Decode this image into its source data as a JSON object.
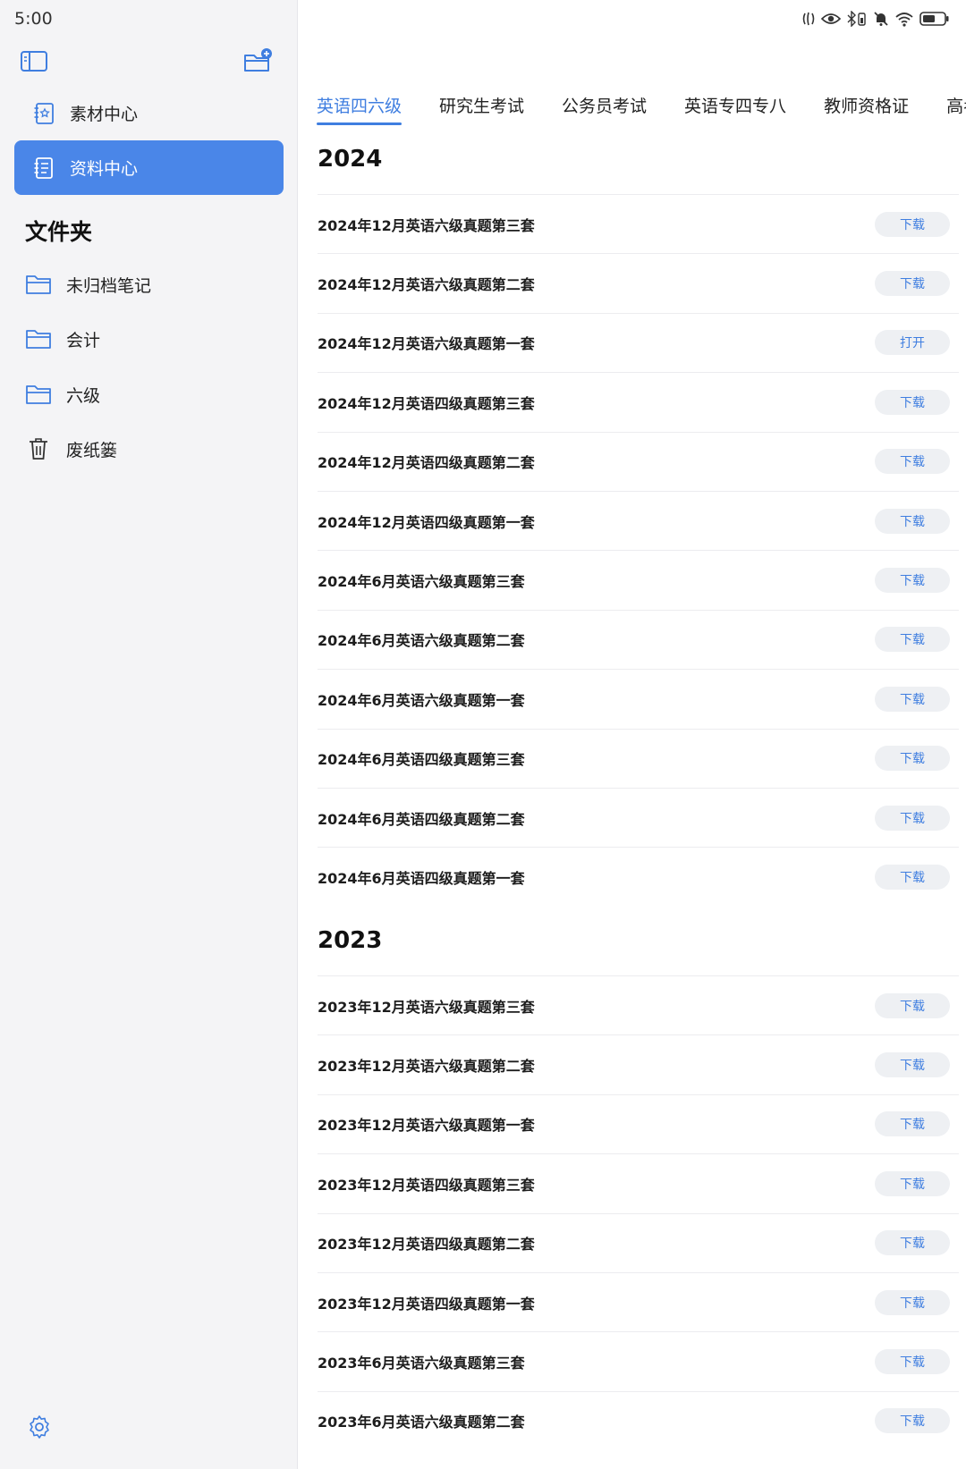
{
  "status_bar": {
    "time": "5:00"
  },
  "sidebar": {
    "nav": [
      {
        "label": "素材中心"
      },
      {
        "label": "资料中心"
      }
    ],
    "folder_heading": "文件夹",
    "folders": [
      {
        "label": "未归档笔记"
      },
      {
        "label": "会计"
      },
      {
        "label": "六级"
      },
      {
        "label": "废纸篓"
      }
    ]
  },
  "tabs": [
    "英语四六级",
    "研究生考试",
    "公务员考试",
    "英语专四专八",
    "教师资格证",
    "高考"
  ],
  "sections": [
    {
      "year": "2024",
      "items": [
        {
          "title": "2024年12月英语六级真题第三套",
          "action": "下载"
        },
        {
          "title": "2024年12月英语六级真题第二套",
          "action": "下载"
        },
        {
          "title": "2024年12月英语六级真题第一套",
          "action": "打开"
        },
        {
          "title": "2024年12月英语四级真题第三套",
          "action": "下载"
        },
        {
          "title": "2024年12月英语四级真题第二套",
          "action": "下载"
        },
        {
          "title": "2024年12月英语四级真题第一套",
          "action": "下载"
        },
        {
          "title": "2024年6月英语六级真题第三套",
          "action": "下载"
        },
        {
          "title": "2024年6月英语六级真题第二套",
          "action": "下载"
        },
        {
          "title": "2024年6月英语六级真题第一套",
          "action": "下载"
        },
        {
          "title": "2024年6月英语四级真题第三套",
          "action": "下载"
        },
        {
          "title": "2024年6月英语四级真题第二套",
          "action": "下载"
        },
        {
          "title": "2024年6月英语四级真题第一套",
          "action": "下载"
        }
      ]
    },
    {
      "year": "2023",
      "items": [
        {
          "title": "2023年12月英语六级真题第三套",
          "action": "下载"
        },
        {
          "title": "2023年12月英语六级真题第二套",
          "action": "下载"
        },
        {
          "title": "2023年12月英语六级真题第一套",
          "action": "下载"
        },
        {
          "title": "2023年12月英语四级真题第三套",
          "action": "下载"
        },
        {
          "title": "2023年12月英语四级真题第二套",
          "action": "下载"
        },
        {
          "title": "2023年12月英语四级真题第一套",
          "action": "下载"
        },
        {
          "title": "2023年6月英语六级真题第三套",
          "action": "下载"
        },
        {
          "title": "2023年6月英语六级真题第二套",
          "action": "下载"
        }
      ]
    }
  ],
  "colors": {
    "accent": "#4a86e8",
    "accent_text": "#3f7ee0",
    "sidebar_bg": "#f4f4f6",
    "pill_bg": "#eef0f3"
  }
}
